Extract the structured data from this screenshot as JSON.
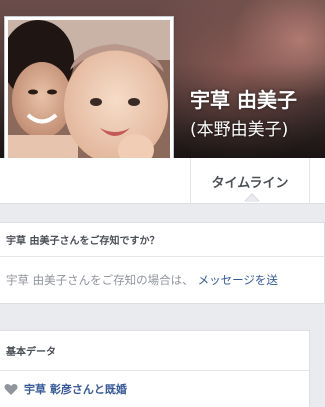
{
  "profile": {
    "name": "宇草 由美子",
    "alternate_name": "(本野由美子)"
  },
  "tabs": {
    "timeline_label": "タイムライン"
  },
  "do_you_know": {
    "title": "宇草 由美子さんをご存知ですか？",
    "body_text": "宇草 由美子さんをご存知の場合は、",
    "link_text": "メッセージを送"
  },
  "basic_data": {
    "title": "基本データ",
    "relationship": "宇草 彰彦さんと既婚",
    "relationship_icon": "heart-icon"
  }
}
